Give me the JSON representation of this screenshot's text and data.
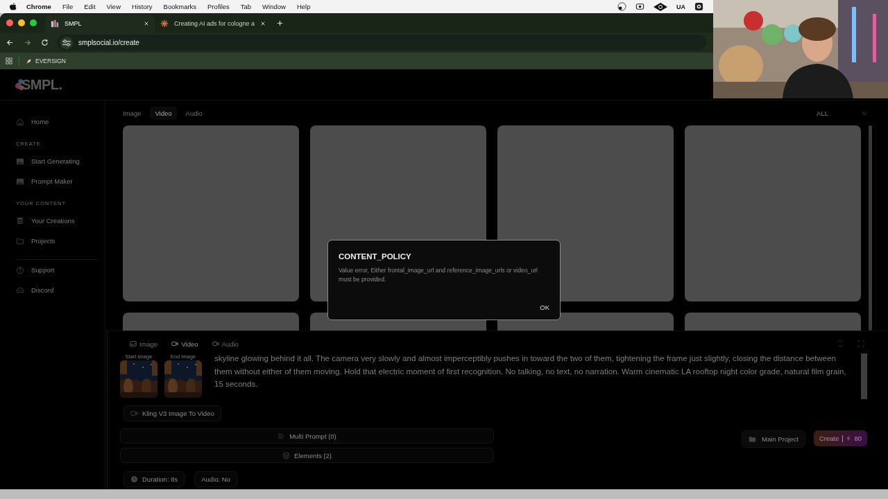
{
  "menubar": {
    "app": "Chrome",
    "items": [
      "File",
      "Edit",
      "View",
      "History",
      "Bookmarks",
      "Profiles",
      "Tab",
      "Window",
      "Help"
    ],
    "status_text": "UA"
  },
  "browser": {
    "tabs": [
      {
        "title": "SMPL",
        "selected": true
      },
      {
        "title": "Creating AI ads for cologne a",
        "selected": false
      }
    ],
    "url": "smplsocial.io/create",
    "bookmarks": [
      "EVERSIGN"
    ]
  },
  "app": {
    "logo": "SMPL.",
    "sidebar": [
      {
        "kind": "link",
        "label": "Home"
      },
      {
        "kind": "heading",
        "label": "CREATE"
      },
      {
        "kind": "link",
        "label": "Start Generating"
      },
      {
        "kind": "link",
        "label": "Prompt Maker"
      },
      {
        "kind": "heading",
        "label": "YOUR CONTENT"
      },
      {
        "kind": "link",
        "label": "Your Creations"
      },
      {
        "kind": "link",
        "label": "Projects"
      },
      {
        "kind": "divider"
      },
      {
        "kind": "link",
        "label": "Support"
      },
      {
        "kind": "link",
        "label": "Discord"
      }
    ],
    "media_tabs": [
      {
        "label": "Image",
        "selected": false
      },
      {
        "label": "Video",
        "selected": true
      },
      {
        "label": "Audio",
        "selected": false
      }
    ],
    "filter": "ALL",
    "cards": [
      {
        "kind": "placeholder"
      },
      {
        "kind": "placeholder"
      },
      {
        "kind": "placeholder"
      },
      {
        "kind": "placeholder"
      },
      {
        "kind": "placeholder"
      },
      {
        "kind": "placeholder"
      },
      {
        "kind": "placeholder"
      },
      {
        "kind": "placeholder"
      }
    ],
    "composer": {
      "tabs": [
        {
          "label": "Image",
          "selected": false
        },
        {
          "label": "Video",
          "selected": true
        },
        {
          "label": "Audio",
          "selected": false
        }
      ],
      "frames": [
        {
          "label": "Start Image",
          "kind": "picture"
        },
        {
          "label": "End Image",
          "kind": "picture"
        }
      ],
      "prompt": "skyline glowing behind it all. The camera very slowly and almost imperceptibly pushes in toward the two of them, tightening the frame just slightly, closing the distance between them without either of them moving. Hold that electric moment of first recognition. No talking, no text, no narration. Warm cinematic LA rooftop night color grade, natural film grain, 15 seconds.",
      "model": "Kling V3 Image To Video",
      "multi_prompt": "Multi Prompt (0)",
      "elements": "Elements (2)",
      "duration": "Duration: 8s",
      "audio": "Audio: No",
      "project": "Main Project",
      "create": {
        "label": "Create",
        "cost": "80"
      }
    },
    "dialog": {
      "title": "CONTENT_POLICY",
      "message": "Value error, Either frontal_image_url and reference_image_urls or video_url must be provided.",
      "button": "OK"
    }
  }
}
